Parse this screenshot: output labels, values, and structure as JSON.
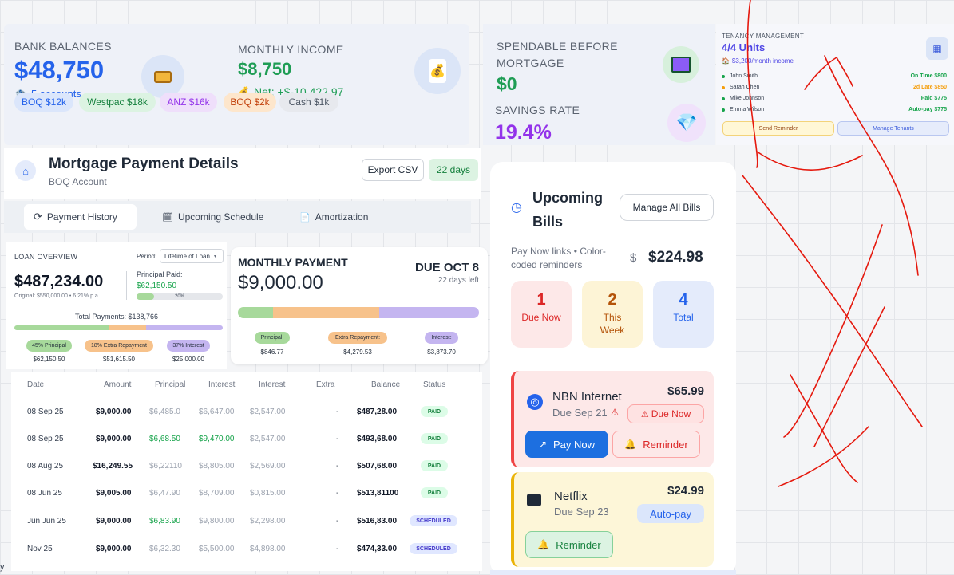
{
  "bank": {
    "label": "BANK BALANCES",
    "total": "$48,750",
    "accounts": "5 accounts",
    "income_label": "MONTHLY INCOME",
    "income": "$8,750",
    "net": "Net: +$-10,422.97",
    "chips": [
      "BOQ $12k",
      "Westpac $18k",
      "ANZ $16k",
      "BOQ $2k",
      "Cash $1k"
    ]
  },
  "spendable": {
    "label_line1": "SPENDABLE BEFORE",
    "label_line2": "MORTGAGE",
    "value": "$0",
    "savings_label": "SAVINGS RATE",
    "savings_value": "19.4%"
  },
  "tenancy": {
    "label": "TENANCY MANAGEMENT",
    "units": "4/4 Units",
    "income": "$3,200/month income",
    "tenants": [
      {
        "name": "John Smith",
        "status": "On Time $800",
        "color": "#16a34a"
      },
      {
        "name": "Sarah Chen",
        "status": "2d Late $850",
        "color": "#f59e0b"
      },
      {
        "name": "Mike Johnson",
        "status": "Paid $775",
        "color": "#16a34a"
      },
      {
        "name": "Emma Wilson",
        "status": "Auto-pay $775",
        "color": "#16a34a"
      }
    ],
    "send_reminder": "Send Reminder",
    "manage_tenants": "Manage Tenants"
  },
  "mortgage": {
    "title": "Mortgage Payment Details",
    "subtitle": "BOQ Account",
    "export": "Export CSV",
    "days": "22 days",
    "tabs": [
      "Payment History",
      "Upcoming Schedule",
      "Amortization"
    ]
  },
  "loan": {
    "label": "LOAN OVERVIEW",
    "period_label": "Period:",
    "period_value": "Lifetime of Loan",
    "balance": "$487,234.00",
    "original": "Original: $550,000.00 • 6.21% p.a.",
    "principal_paid_label": "Principal Paid:",
    "principal_paid": "$62,150.50",
    "progress_pct": "20%",
    "progress": 0.2,
    "total_payments": "Total Payments: $138,766",
    "breakdown": [
      {
        "label": "45% Principal",
        "value": "$62,150.50",
        "color": "#a7d99b"
      },
      {
        "label": "18% Extra Repayment",
        "value": "$51,615.50",
        "color": "#f7c28b"
      },
      {
        "label": "37% Interest",
        "value": "$25,000.00",
        "color": "#c4b5f0"
      }
    ]
  },
  "monthly": {
    "label": "MONTHLY PAYMENT",
    "amount": "$9,000.00",
    "due": "DUE OCT 8",
    "days_left": "22 days left",
    "parts": [
      {
        "label": "Principal:",
        "value": "$846.77"
      },
      {
        "label": "Extra Repayment:",
        "value": "$4,279.53"
      },
      {
        "label": "Interest:",
        "value": "$3,873.70"
      }
    ]
  },
  "table": {
    "headers": [
      "Date",
      "Amount",
      "Principal",
      "Interest",
      "Interest",
      "Extra",
      "Balance",
      "Status"
    ],
    "rows": [
      [
        "08 Sep 25",
        "$9,000.00",
        "$6,485.0",
        "$6,647.00",
        "$2,547.00",
        "-",
        "$487,28.00",
        "PAID"
      ],
      [
        "08 Sep 25",
        "$9,000.00",
        "$6,68.50",
        "$9,470.00",
        "$2,547.00",
        "-",
        "$493,68.00",
        "PAID"
      ],
      [
        "08 Aug 25",
        "$16,249.55",
        "$6,22110",
        "$8,805.00",
        "$2,569.00",
        "-",
        "$507,68.00",
        "PAID"
      ],
      [
        "08 Jun 25",
        "$9,005.00",
        "$6,47.90",
        "$8,709.00",
        "$0,815.00",
        "-",
        "$513,81100",
        "PAID"
      ],
      [
        "Jun Jun 25",
        "$9,000.00",
        "$6,83.90",
        "$9,800.00",
        "$2,298.00",
        "-",
        "$516,83.00",
        "SCHEDULED"
      ],
      [
        "Nov 25",
        "$9,000.00",
        "$6,32.30",
        "$5,500.00",
        "$4,898.00",
        "-",
        "$474,33.00",
        "SCHEDULED"
      ]
    ]
  },
  "bills": {
    "title_line1": "Upcoming",
    "title_line2": "Bills",
    "manage": "Manage All Bills",
    "desc": "Pay Now links • Color-coded reminders",
    "total": "$224.98",
    "counts": [
      {
        "num": "1",
        "label": "Due Now"
      },
      {
        "num": "2",
        "label": "This Week"
      },
      {
        "num": "4",
        "label": "Total"
      }
    ],
    "items": [
      {
        "name": "NBN Internet",
        "due": "Due Sep 21",
        "amount": "$65.99",
        "badge": "Due Now",
        "pay": "Pay Now",
        "reminder": "Reminder"
      },
      {
        "name": "Netflix",
        "due": "Due Sep 23",
        "amount": "$24.99",
        "badge": "Auto-pay",
        "reminder": "Reminder"
      }
    ]
  },
  "edge": {
    "char": "y"
  },
  "colors": {
    "blue": "#2563eb",
    "green": "#1f9d55",
    "purple": "#9333ea",
    "red_ink": "#e5190e"
  }
}
